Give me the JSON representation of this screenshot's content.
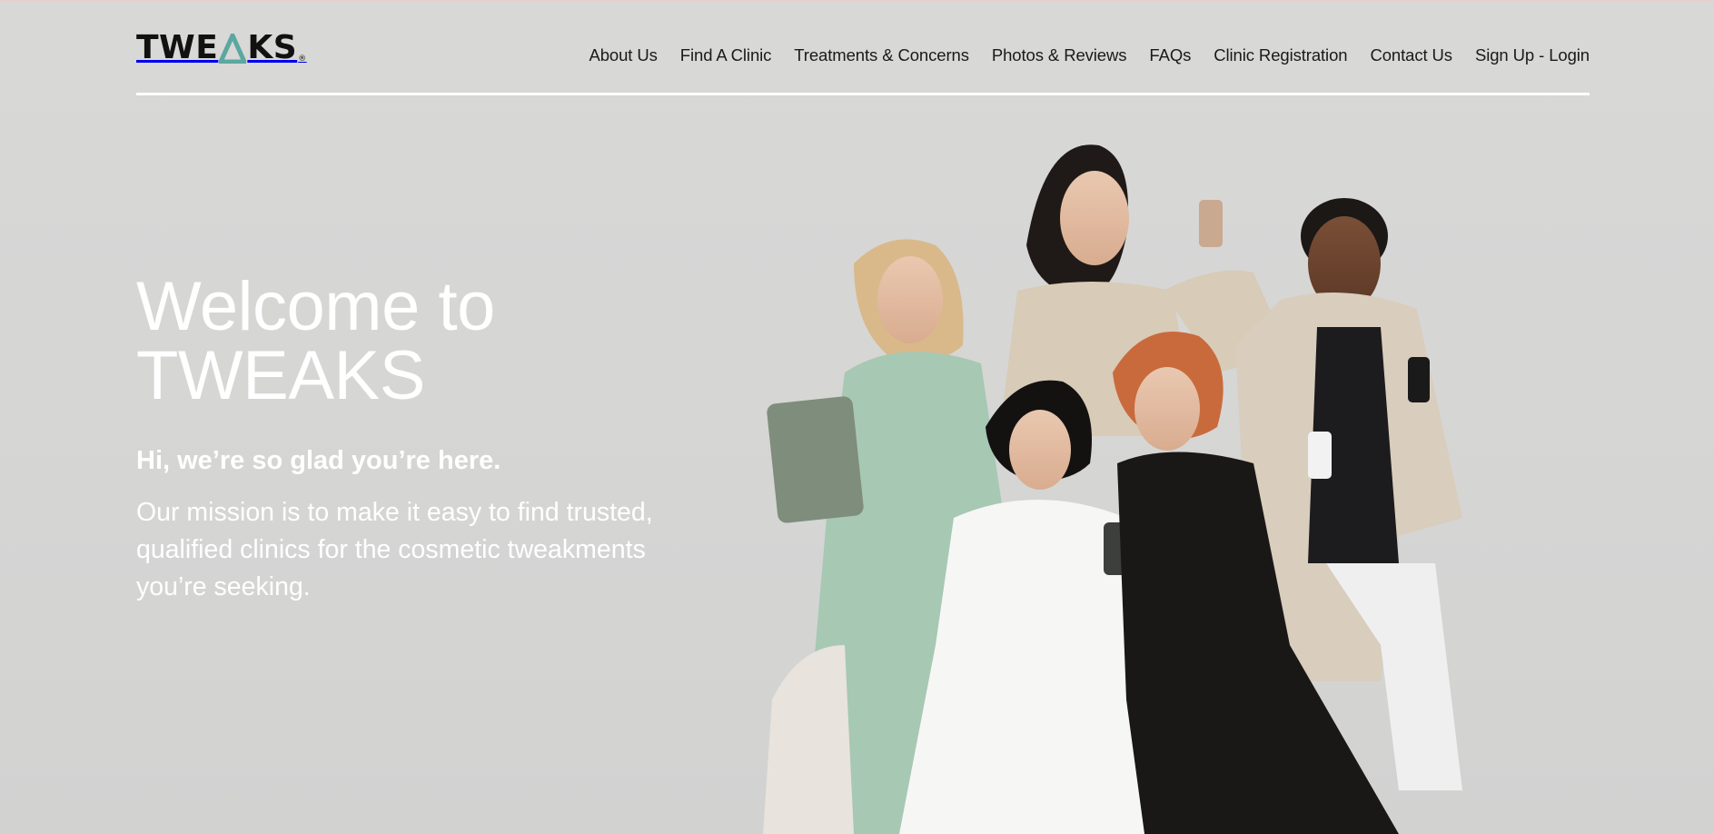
{
  "brand": {
    "name": "TWEAKS",
    "letters_before": "TWE",
    "letters_after": "KS",
    "registered": "®",
    "accent": "#5aa8a0"
  },
  "nav": {
    "items": [
      {
        "label": "About Us"
      },
      {
        "label": "Find A Clinic"
      },
      {
        "label": "Treatments & Concerns"
      },
      {
        "label": "Photos & Reviews"
      },
      {
        "label": "FAQs"
      },
      {
        "label": "Clinic Registration"
      },
      {
        "label": "Contact Us"
      },
      {
        "label": "Sign Up - Login"
      }
    ]
  },
  "hero": {
    "title_line1": "Welcome to",
    "title_line2": "TWEAKS",
    "subtitle": "Hi, we’re so glad you’re here.",
    "body": "Our mission is to make it easy to find trusted, qualified clinics for the cosmetic tweakments you’re seeking.",
    "image_subject": "group-photo-people-with-devices"
  },
  "colors": {
    "background": "#d6d6d5",
    "text_light": "#ffffff",
    "text_dark": "#111111"
  }
}
